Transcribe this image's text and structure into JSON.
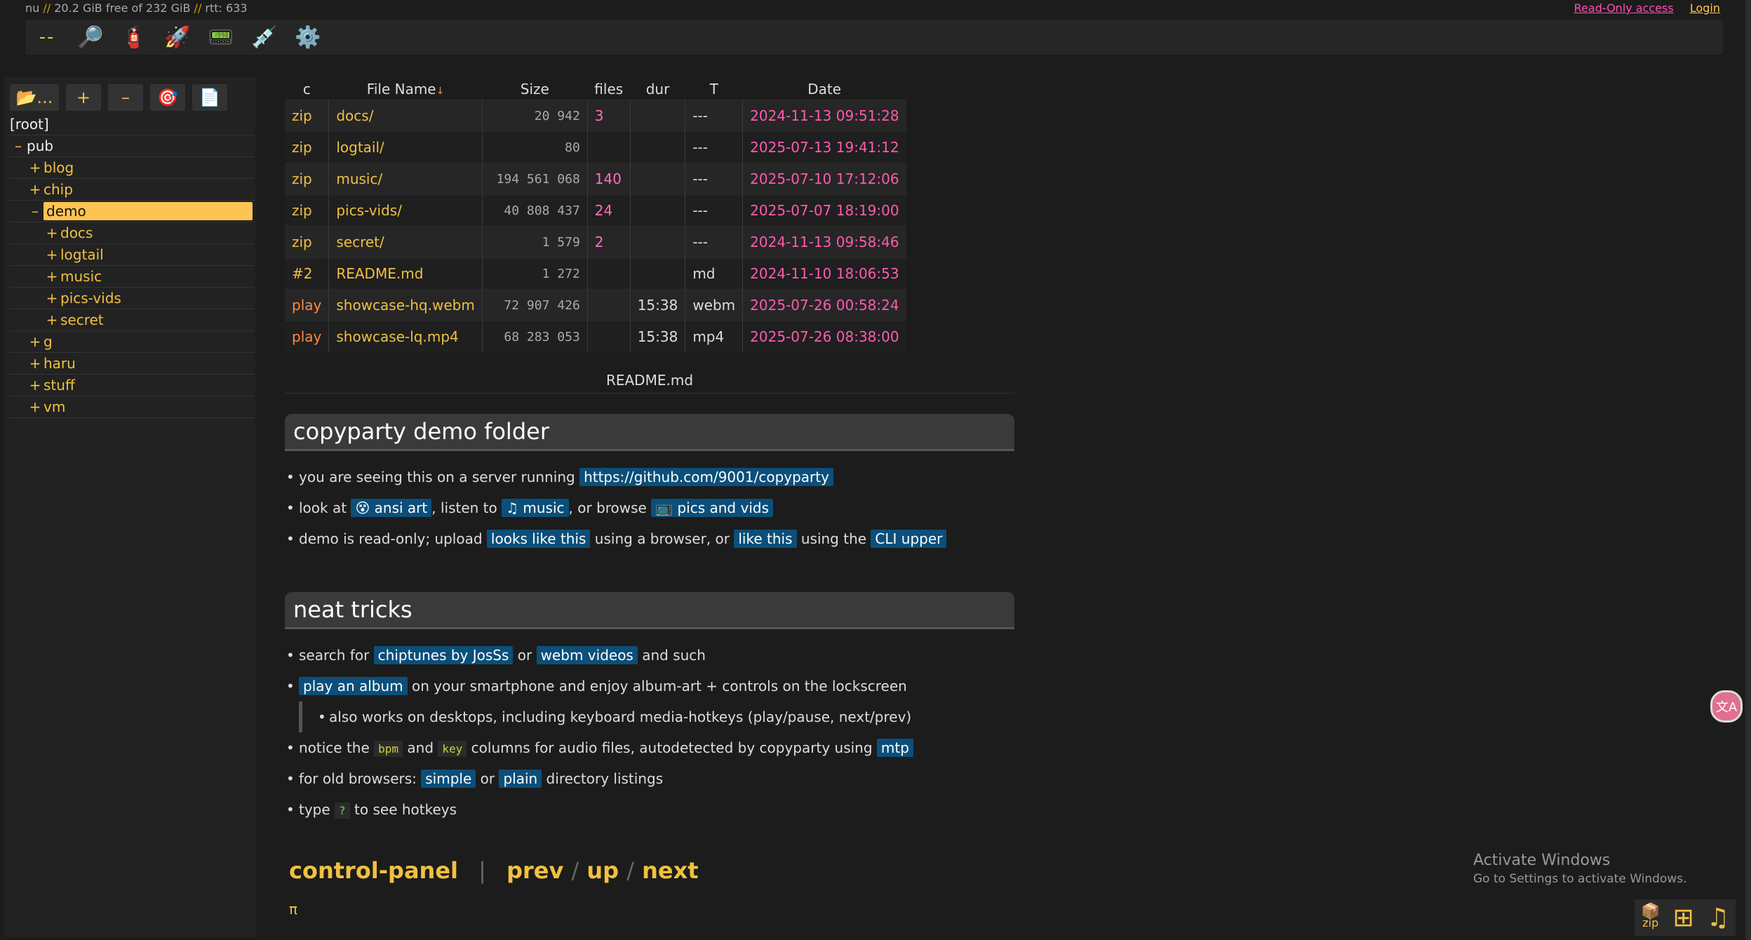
{
  "status": {
    "host": "nu",
    "free": "20.2 GiB free of 232 GiB",
    "rtt": "rtt: 633",
    "sep": "//"
  },
  "top_links": {
    "read_only": "Read-Only access",
    "login": "Login"
  },
  "toolbar": {
    "buttons": [
      {
        "name": "dash-icon",
        "glyph": "--"
      },
      {
        "name": "search-icon",
        "glyph": "🔎"
      },
      {
        "name": "extinguisher-icon",
        "glyph": "🧯"
      },
      {
        "name": "rocket-icon",
        "glyph": "🚀"
      },
      {
        "name": "screen-icon",
        "glyph": "📟"
      },
      {
        "name": "syringe-icon",
        "glyph": "💉"
      },
      {
        "name": "gear-icon",
        "glyph": "⚙️"
      }
    ]
  },
  "treebar": {
    "folder_label": "📂...",
    "plus": "+",
    "minus": "–",
    "target": "🎯",
    "page": "📄"
  },
  "tree": [
    {
      "label": "[root]",
      "pm": "",
      "level": "root"
    },
    {
      "label": "pub",
      "pm": "–",
      "level": "l1"
    },
    {
      "label": "blog",
      "pm": "+",
      "level": "l2"
    },
    {
      "label": "chip",
      "pm": "+",
      "level": "l2"
    },
    {
      "label": "demo",
      "pm": "–",
      "level": "l2",
      "selected": true
    },
    {
      "label": "docs",
      "pm": "+",
      "level": "l3"
    },
    {
      "label": "logtail",
      "pm": "+",
      "level": "l3"
    },
    {
      "label": "music",
      "pm": "+",
      "level": "l3"
    },
    {
      "label": "pics-vids",
      "pm": "+",
      "level": "l3"
    },
    {
      "label": "secret",
      "pm": "+",
      "level": "l3"
    },
    {
      "label": "g",
      "pm": "+",
      "level": "l2"
    },
    {
      "label": "haru",
      "pm": "+",
      "level": "l2"
    },
    {
      "label": "stuff",
      "pm": "+",
      "level": "l2"
    },
    {
      "label": "vm",
      "pm": "+",
      "level": "l2"
    }
  ],
  "files": {
    "headers": {
      "c": "c",
      "name": "File Name",
      "sort": "↓",
      "size": "Size",
      "files": "files",
      "dur": "dur",
      "t": "T",
      "date": "Date"
    },
    "rows": [
      {
        "c": "zip",
        "name": "docs/",
        "size": "20 942",
        "files": "3",
        "dur": "",
        "t": "---",
        "date": "2024-11-13 09:51:28"
      },
      {
        "c": "zip",
        "name": "logtail/",
        "size": "80",
        "files": "",
        "dur": "",
        "t": "---",
        "date": "2025-07-13 19:41:12"
      },
      {
        "c": "zip",
        "name": "music/",
        "size": "194 561 068",
        "files": "140",
        "dur": "",
        "t": "---",
        "date": "2025-07-10 17:12:06"
      },
      {
        "c": "zip",
        "name": "pics-vids/",
        "size": "40 808 437",
        "files": "24",
        "dur": "",
        "t": "---",
        "date": "2025-07-07 18:19:00"
      },
      {
        "c": "zip",
        "name": "secret/",
        "size": "1 579",
        "files": "2",
        "dur": "",
        "t": "---",
        "date": "2024-11-13 09:58:46"
      },
      {
        "c": "#2",
        "name": "README.md",
        "size": "1 272",
        "files": "",
        "dur": "",
        "t": "md",
        "date": "2024-11-10 18:06:53"
      },
      {
        "c": "play",
        "name": "showcase-hq.webm",
        "size": "72 907 426",
        "files": "",
        "dur": "15:38",
        "t": "webm",
        "date": "2025-07-26 00:58:24"
      },
      {
        "c": "play",
        "name": "showcase-lq.mp4",
        "size": "68 283 053",
        "files": "",
        "dur": "15:38",
        "t": "mp4",
        "date": "2025-07-26 08:38:00"
      }
    ]
  },
  "readme": {
    "label": "README.md",
    "h1": "copyparty demo folder",
    "b1_pre": "you are seeing this on a server running ",
    "b1_link": "https://github.com/9001/copyparty",
    "b2_pre": "look at ",
    "b2_l1": "😵 ansi art",
    "b2_mid1": ", listen to ",
    "b2_l2": "♫ music",
    "b2_mid2": ", or browse ",
    "b2_l3": "📺 pics and vids",
    "b3_pre": "demo is read-only;  upload ",
    "b3_l1": "looks like this",
    "b3_mid1": " using a browser, or ",
    "b3_l2": "like this",
    "b3_mid2": " using the ",
    "b3_l3": "CLI upper",
    "h2": "neat tricks",
    "t1_pre": "search for ",
    "t1_l1": "chiptunes by JosSs",
    "t1_mid": " or ",
    "t1_l2": "webm videos",
    "t1_post": " and such",
    "t2_l": "play an album",
    "t2_post": " on your smartphone and enjoy album-art + controls on the lockscreen",
    "t2_sub": "also works on desktops, including keyboard media-hotkeys (play/pause, next/prev)",
    "t3_pre": "notice the ",
    "t3_c1": "bpm",
    "t3_mid": " and ",
    "t3_c2": "key",
    "t3_post": " columns for audio files, autodetected by copyparty using ",
    "t3_l": "mtp",
    "t4_pre": "for old browsers: ",
    "t4_l1": "simple",
    "t4_mid": " or ",
    "t4_l2": "plain",
    "t4_post": " directory listings",
    "t5_pre": "type ",
    "t5_c": "?",
    "t5_post": " to see hotkeys"
  },
  "bottom_nav": {
    "control": "control-panel",
    "bar": "|",
    "prev": "prev",
    "slash": "/",
    "up": "up",
    "next": "next",
    "pi": "π"
  },
  "activate": {
    "title": "Activate Windows",
    "sub": "Go to Settings to activate Windows."
  },
  "widgets": {
    "zip_glyph": "📦",
    "zip_label": "zip",
    "grid": "⊞",
    "music": "♫",
    "translate": "文A"
  }
}
